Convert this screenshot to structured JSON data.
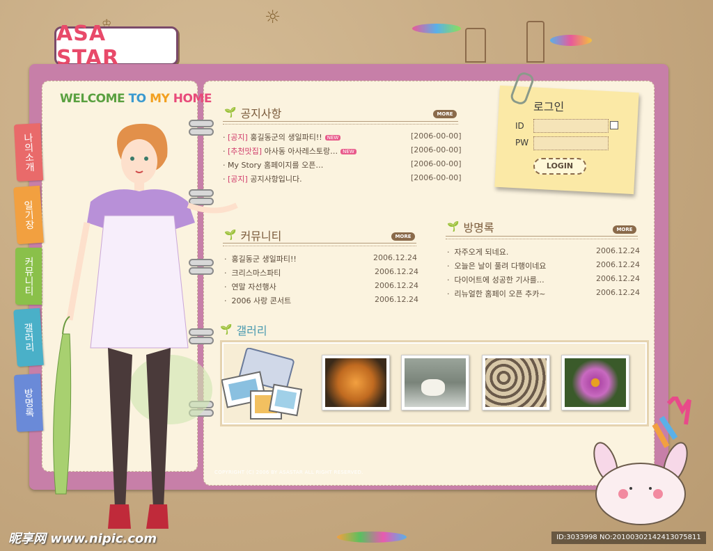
{
  "logo": {
    "text": "ASA STAR"
  },
  "welcome": {
    "word1": "WELCOME",
    "word2": "TO",
    "word3": "MY",
    "word4": "HOME"
  },
  "tabs": [
    {
      "label": "나의소개",
      "color": "#e96a6a"
    },
    {
      "label": "일기장",
      "color": "#f2a040"
    },
    {
      "label": "커뮤니티",
      "color": "#8ac04a"
    },
    {
      "label": "갤러리",
      "color": "#4ab0c8"
    },
    {
      "label": "방명록",
      "color": "#6a8ad8"
    }
  ],
  "notice": {
    "title": "공지사항",
    "more": "MORE",
    "items": [
      {
        "tag": "[공지]",
        "text": " 홍길동군의 생일파티!!",
        "new": "NEW",
        "date": "[2006-00-00]"
      },
      {
        "tag": "[추천맛집]",
        "text": " 아사동 아사레스토랑…",
        "new": "NEW",
        "date": "[2006-00-00]"
      },
      {
        "tag": "",
        "text": "My Story 홈페이지를 오픈…",
        "new": "",
        "date": "[2006-00-00]"
      },
      {
        "tag": "[공지]",
        "text": " 공지사항입니다.",
        "new": "",
        "date": "[2006-00-00]"
      }
    ]
  },
  "login": {
    "title": "로그인",
    "id_label": "ID",
    "pw_label": "PW",
    "button": "LOGIN"
  },
  "community": {
    "title": "커뮤니티",
    "more": "MORE",
    "items": [
      {
        "text": "홍길동군 생일파티!!",
        "date": "2006.12.24"
      },
      {
        "text": "크리스마스파티",
        "date": "2006.12.24"
      },
      {
        "text": "연말 자선행사",
        "date": "2006.12.24"
      },
      {
        "text": "2006 사랑 콘서트",
        "date": "2006.12.24"
      }
    ]
  },
  "guestbook": {
    "title": "방명록",
    "more": "MORE",
    "items": [
      {
        "text": "자주오게 되네요.",
        "date": "2006.12.24"
      },
      {
        "text": "오늘은 날이 풀려 다행이네요",
        "date": "2006.12.24"
      },
      {
        "text": "다이어트에 성공한 기사를…",
        "date": "2006.12.24"
      },
      {
        "text": "리뉴얼한 홈페이 오픈 추카~",
        "date": "2006.12.24"
      }
    ]
  },
  "gallery": {
    "title": "갤러리",
    "thumbs": [
      "sweet-potato-photo",
      "polar-bear-photo",
      "food-table-photo",
      "purple-flower-photo"
    ]
  },
  "copyright": "COPYRIGHT (C) 2006 BY ASASTAR ALL RIGHT RESERVED.",
  "watermark": {
    "site": "昵享网 www.nipic.com",
    "id": "ID:3033998 NO:20100302142413075811"
  }
}
